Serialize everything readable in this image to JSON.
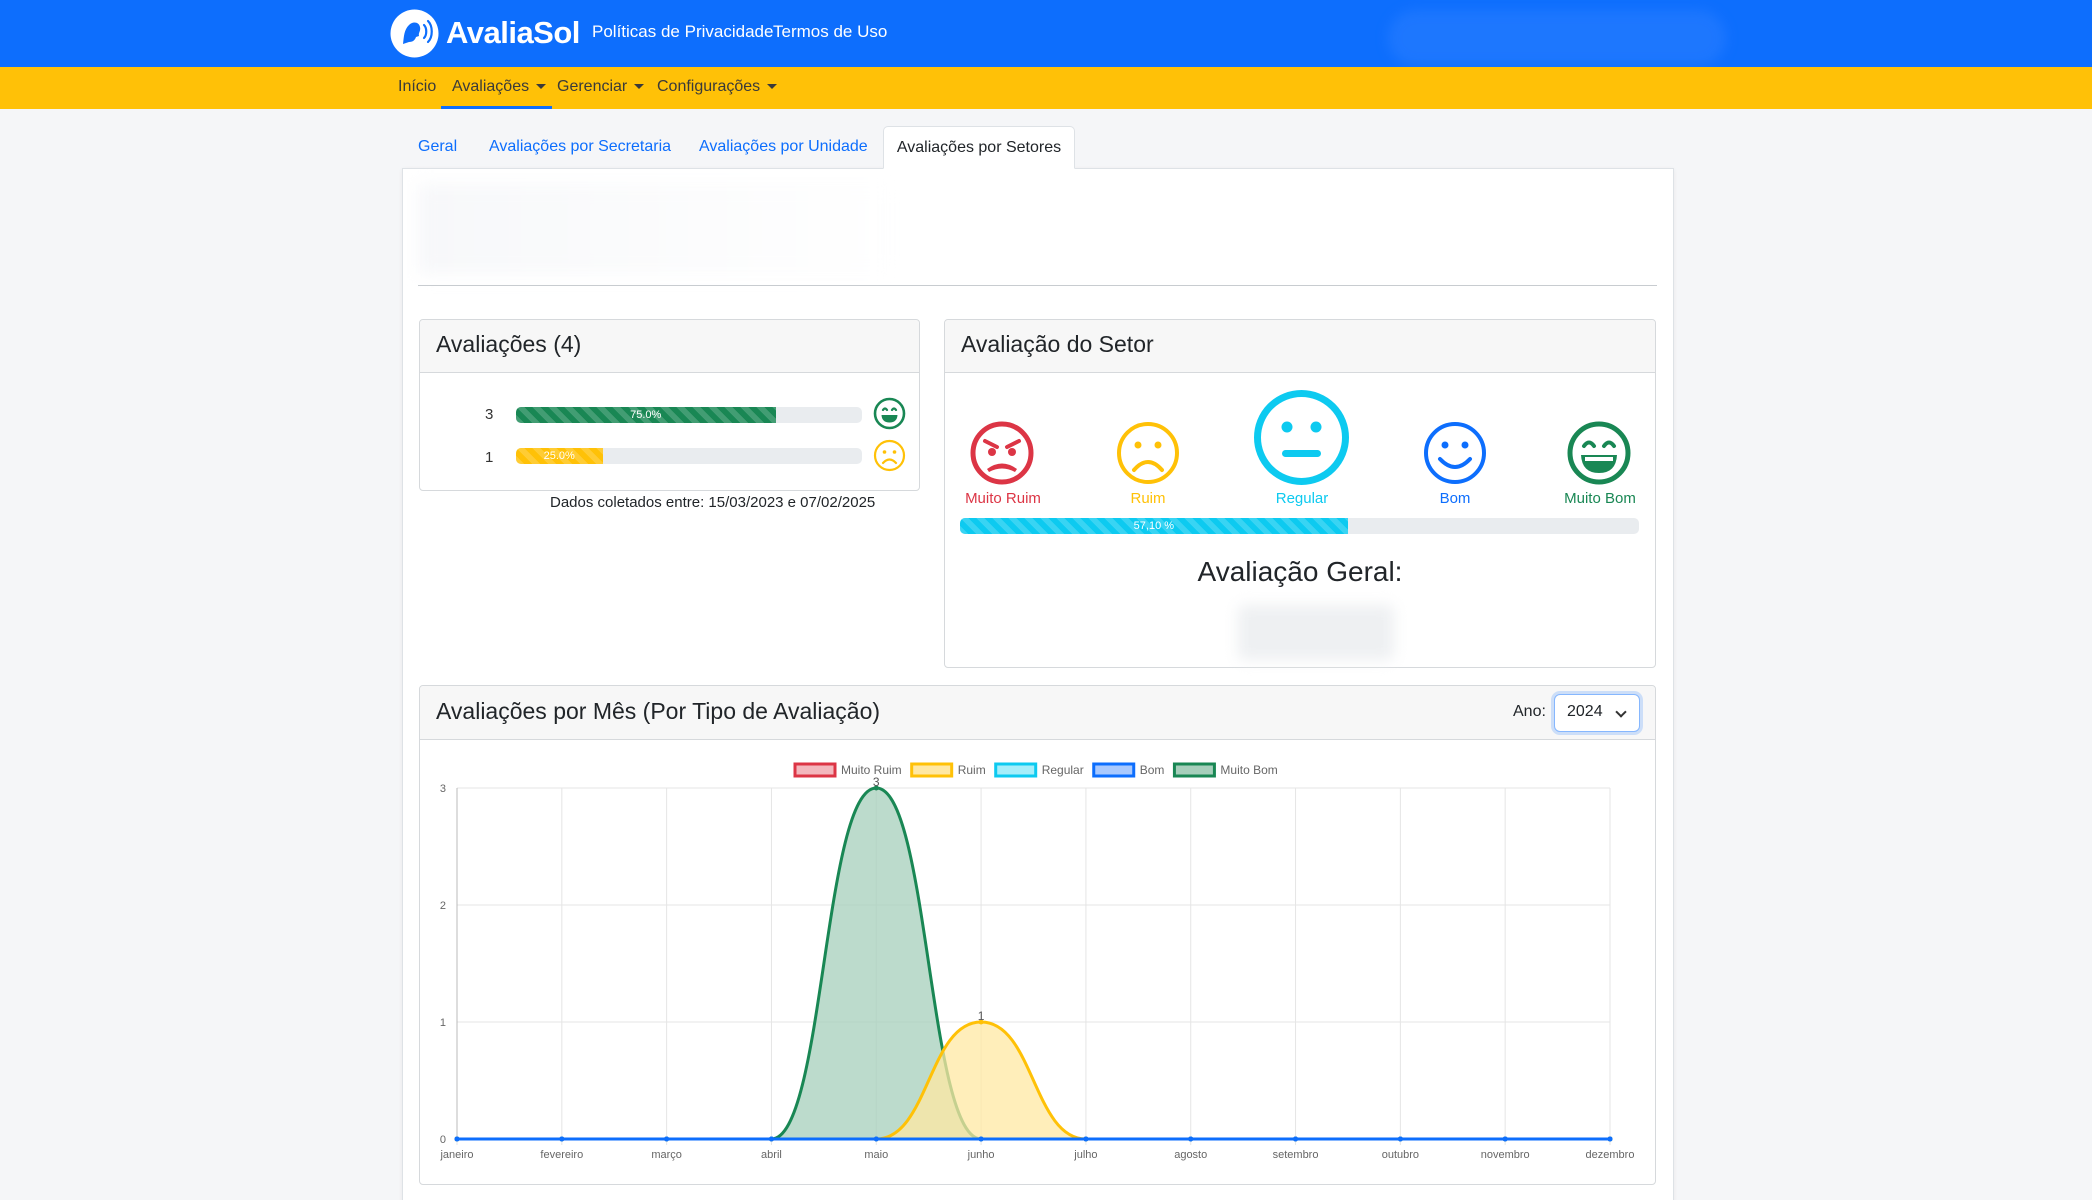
{
  "header": {
    "brand": "AvaliaSol",
    "links": [
      "Políticas de Privacidade",
      "Termos de Uso"
    ]
  },
  "nav": {
    "items": [
      {
        "label": "Início",
        "dropdown": false
      },
      {
        "label": "Avaliações",
        "dropdown": true,
        "active": true
      },
      {
        "label": "Gerenciar",
        "dropdown": true
      },
      {
        "label": "Configurações",
        "dropdown": true
      }
    ]
  },
  "tabs": [
    {
      "label": "Geral"
    },
    {
      "label": "Avaliações por Secretaria"
    },
    {
      "label": "Avaliações por Unidade"
    },
    {
      "label": "Avaliações por Setores",
      "active": true
    }
  ],
  "ratings_card": {
    "title": "Avaliações (4)",
    "rows": [
      {
        "count": "3",
        "percent": 75.0,
        "percent_label": "75.0%",
        "color": "#198754",
        "icon": "grinning-face-icon"
      },
      {
        "count": "1",
        "percent": 25.0,
        "percent_label": "25.0%",
        "color": "#ffc107",
        "icon": "sad-face-icon"
      }
    ],
    "collected": "Dados coletados entre: 15/03/2023 e 07/02/2025"
  },
  "sector_card": {
    "title": "Avaliação do Setor",
    "faces": [
      {
        "label": "Muito Ruim",
        "color": "#dc3545",
        "icon": "angry-face-icon"
      },
      {
        "label": "Ruim",
        "color": "#ffc107",
        "icon": "sad-face-icon"
      },
      {
        "label": "Regular",
        "color": "#0dcaf0",
        "icon": "neutral-face-icon",
        "selected": true
      },
      {
        "label": "Bom",
        "color": "#0d6efd",
        "icon": "smile-face-icon"
      },
      {
        "label": "Muito Bom",
        "color": "#198754",
        "icon": "grinning-face-icon"
      }
    ],
    "progress_percent": 57.1,
    "progress_label": "57,10 %",
    "overall_label": "Avaliação Geral:"
  },
  "monthly_card": {
    "title": "Avaliações por Mês (Por Tipo de Avaliação)",
    "year_label": "Ano:",
    "year_value": "2024"
  },
  "chart_data": {
    "type": "area",
    "categories": [
      "janeiro",
      "fevereiro",
      "março",
      "abril",
      "maio",
      "junho",
      "julho",
      "agosto",
      "setembro",
      "outubro",
      "novembro",
      "dezembro"
    ],
    "series": [
      {
        "name": "Muito Ruim",
        "values": [
          0,
          0,
          0,
          0,
          0,
          0,
          0,
          0,
          0,
          0,
          0,
          0
        ],
        "color": "#dc3545",
        "fill": "#f3b7bd"
      },
      {
        "name": "Ruim",
        "values": [
          0,
          0,
          0,
          0,
          0,
          1,
          0,
          0,
          0,
          0,
          0,
          0
        ],
        "color": "#ffc107",
        "fill": "#ffe8a3"
      },
      {
        "name": "Regular",
        "values": [
          0,
          0,
          0,
          0,
          0,
          0,
          0,
          0,
          0,
          0,
          0,
          0
        ],
        "color": "#0dcaf0",
        "fill": "#a5eefa"
      },
      {
        "name": "Bom",
        "values": [
          0,
          0,
          0,
          0,
          0,
          0,
          0,
          0,
          0,
          0,
          0,
          0
        ],
        "color": "#0d6efd",
        "fill": "#a9c9fe"
      },
      {
        "name": "Muito Bom",
        "values": [
          0,
          0,
          0,
          0,
          3,
          0,
          0,
          0,
          0,
          0,
          0,
          0
        ],
        "color": "#198754",
        "fill": "#a6cfbb"
      }
    ],
    "yticks": [
      0,
      1,
      2,
      3
    ],
    "ylim": [
      0,
      3
    ],
    "grid": true,
    "legend": "top"
  }
}
